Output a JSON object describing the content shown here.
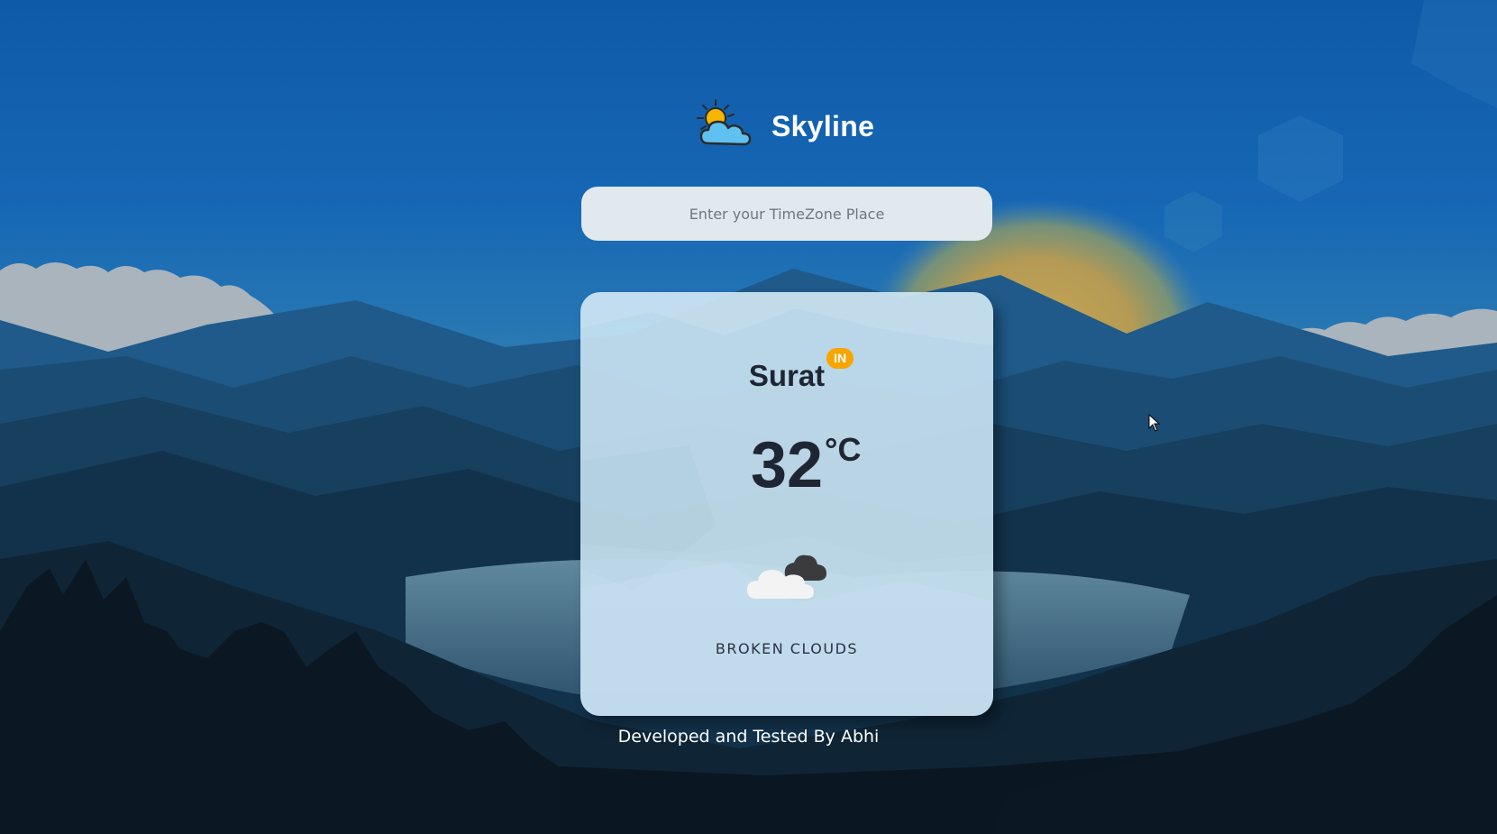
{
  "app": {
    "name": "Skyline",
    "logo_icon": "sun-behind-cloud-icon"
  },
  "search": {
    "placeholder": "Enter your TimeZone Place",
    "value": ""
  },
  "weather": {
    "city": "Surat",
    "country_code": "IN",
    "temperature": "32",
    "unit": "°C",
    "condition": "broken clouds",
    "condition_icon": "broken-clouds-icon"
  },
  "footer": {
    "credit": "Developed and Tested By Abhi"
  },
  "colors": {
    "sky_top": "#1660b2",
    "card": "#cbe4f3",
    "badge": "#f7a500",
    "text_dark": "#1f2633"
  }
}
